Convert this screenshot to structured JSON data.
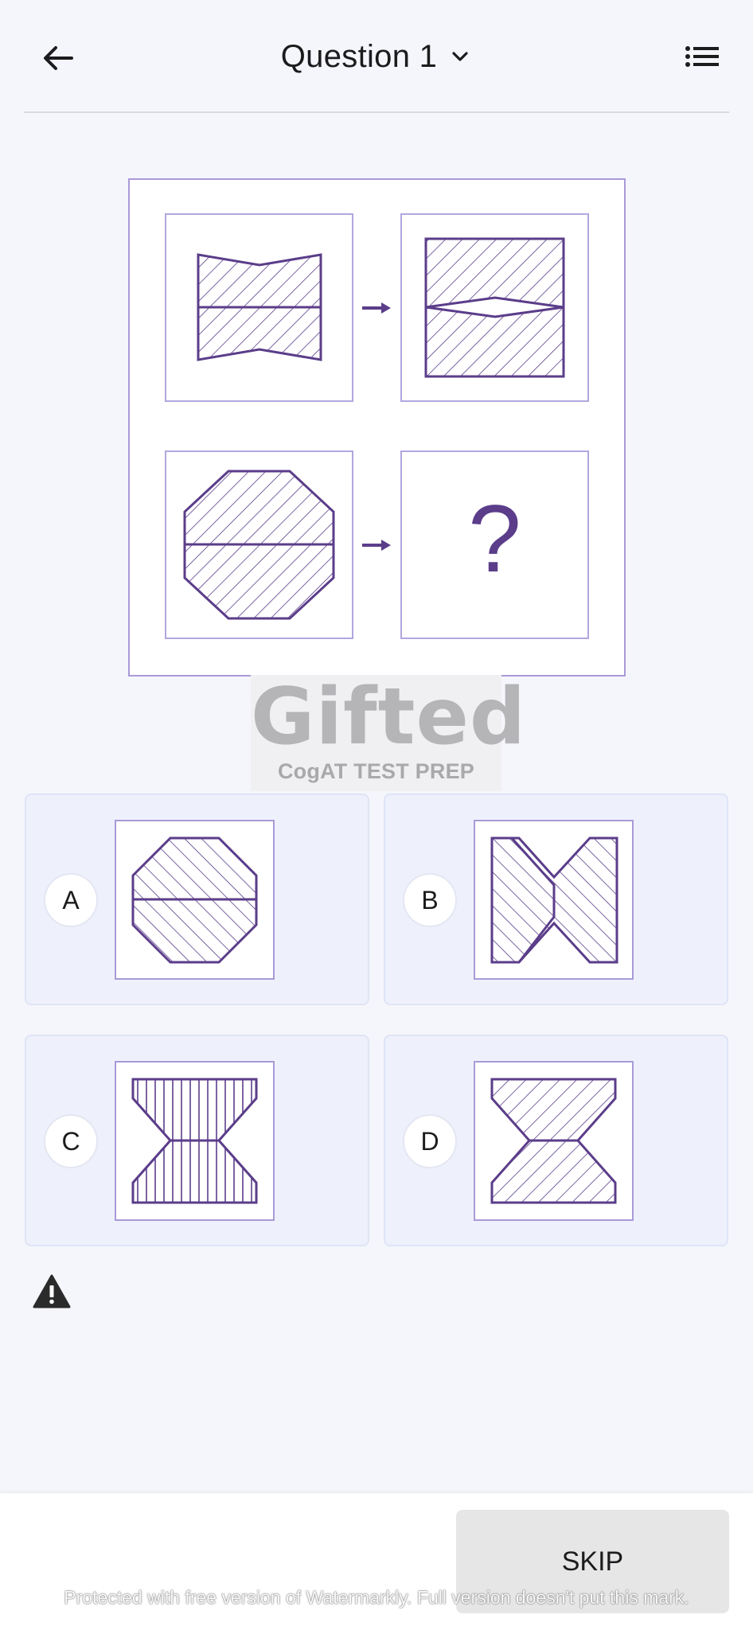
{
  "header": {
    "title": "Question 1",
    "back_icon": "arrow-left-icon",
    "dropdown_icon": "chevron-down-icon",
    "menu_icon": "list-icon"
  },
  "question": {
    "unknown_symbol": "?",
    "accent_color": "#5b3d8a",
    "border_color": "#a99ad8"
  },
  "logo": {
    "main": "Gifted",
    "sub": "CogAT TEST PREP"
  },
  "options": [
    {
      "letter": "A"
    },
    {
      "letter": "B"
    },
    {
      "letter": "C"
    },
    {
      "letter": "D"
    }
  ],
  "report_icon": "warning-icon",
  "footer": {
    "skip_label": "SKIP",
    "watermark": "Protected with free version of Watermarkly. Full version doesn't put this mark."
  }
}
